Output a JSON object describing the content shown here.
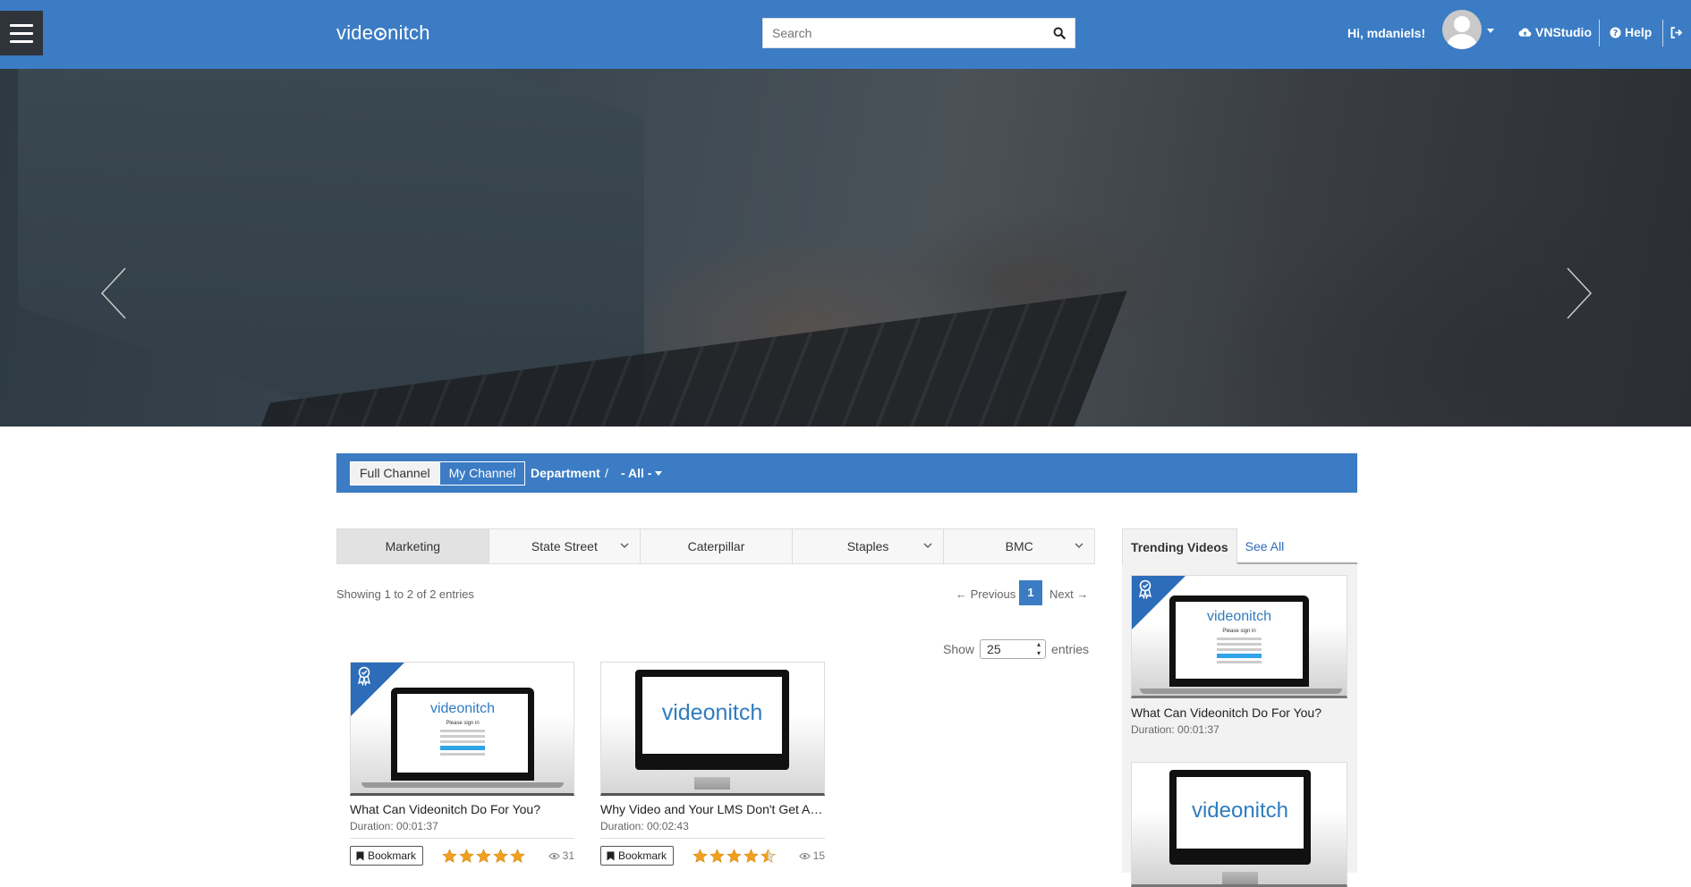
{
  "header": {
    "logo": "videonitch",
    "search_placeholder": "Search",
    "greeting": "Hi, mdaniels!",
    "studio_label": "VNStudio",
    "help_label": "Help"
  },
  "hero": {
    "slide_count": 2,
    "active_slide": 1
  },
  "channel_bar": {
    "full_channel": "Full Channel",
    "my_channel": "My Channel",
    "department_label": "Department",
    "separator": "/",
    "department_value": "- All -"
  },
  "categories": [
    {
      "label": "Marketing",
      "active": true,
      "dropdown": false
    },
    {
      "label": "State Street",
      "active": false,
      "dropdown": true
    },
    {
      "label": "Caterpillar",
      "active": false,
      "dropdown": false
    },
    {
      "label": "Staples",
      "active": false,
      "dropdown": true
    },
    {
      "label": "BMC",
      "active": false,
      "dropdown": true
    }
  ],
  "listing": {
    "showing": "Showing 1 to 2 of 2 entries",
    "prev": "← Previous",
    "page": "1",
    "next": "Next →",
    "show_label": "Show",
    "show_value": "25",
    "entries_label": "entries"
  },
  "videos": [
    {
      "title": "What Can Videonitch Do For You?",
      "duration": "Duration: 00:01:37",
      "bookmark": "Bookmark",
      "rating": 5,
      "views": "31",
      "featured": true,
      "thumb_brand": "videonitch",
      "thumb_text": "Please sign in"
    },
    {
      "title": "Why Video and Your LMS Don't Get Alo...",
      "duration": "Duration: 00:02:43",
      "bookmark": "Bookmark",
      "rating": 4.5,
      "views": "15",
      "featured": false,
      "thumb_brand": "videonitch"
    }
  ],
  "trending": {
    "tab_label": "Trending Videos",
    "see_all": "See All",
    "items": [
      {
        "title": "What Can Videonitch Do For You?",
        "duration": "Duration: 00:01:37",
        "featured": true,
        "thumb_brand": "videonitch",
        "thumb_text": "Please sign in"
      },
      {
        "thumb_brand": "videonitch",
        "featured": false
      }
    ]
  },
  "colors": {
    "primary": "#3b7cc4",
    "dark": "#2f343b",
    "badge": "#2c6cb8",
    "star": "#f0a01e"
  }
}
